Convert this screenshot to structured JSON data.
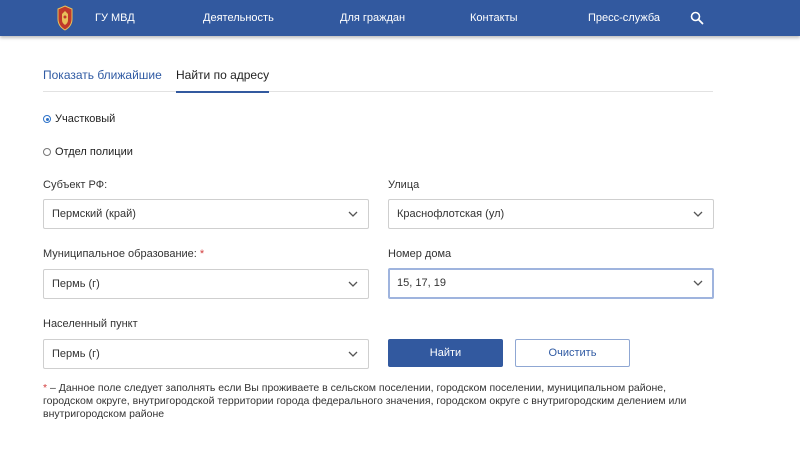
{
  "header": {
    "nav": [
      {
        "label": "ГУ МВД"
      },
      {
        "label": "Деятельность"
      },
      {
        "label": "Для граждан"
      },
      {
        "label": "Контакты"
      },
      {
        "label": "Пресс-служба"
      }
    ],
    "search_icon": "search-icon",
    "emblem_icon": "emblem-icon"
  },
  "tabs": [
    {
      "label": "Показать ближайшие",
      "active": false
    },
    {
      "label": "Найти по адресу",
      "active": true
    }
  ],
  "type_options": [
    {
      "label": "Участковый",
      "checked": true
    },
    {
      "label": "Отдел полиции",
      "checked": false
    }
  ],
  "fields": {
    "subject": {
      "label": "Субъект РФ:",
      "value": "Пермский (край)"
    },
    "street": {
      "label": "Улица",
      "value": "Краснофлотская (ул)"
    },
    "municipality": {
      "label": "Муниципальное образование:",
      "required_mark": "*",
      "value": "Пермь (г)"
    },
    "house": {
      "label": "Номер дома",
      "value": "15, 17, 19"
    },
    "locality": {
      "label": "Населенный пункт",
      "value": "Пермь (г)"
    }
  },
  "buttons": {
    "find": "Найти",
    "clear": "Очистить"
  },
  "note": {
    "mark": "*",
    "text": " – Данное поле следует заполнять если Вы проживаете в сельском поселении, городском поселении, муниципальном районе, городском округе, внутригородской территории города федерального значения, городском округе с внутригородским делением или внутригородском районе"
  },
  "colors": {
    "brand": "#32599f",
    "link": "#2f5aa3",
    "required": "#d23c3c",
    "focus": "#9fb4de"
  }
}
